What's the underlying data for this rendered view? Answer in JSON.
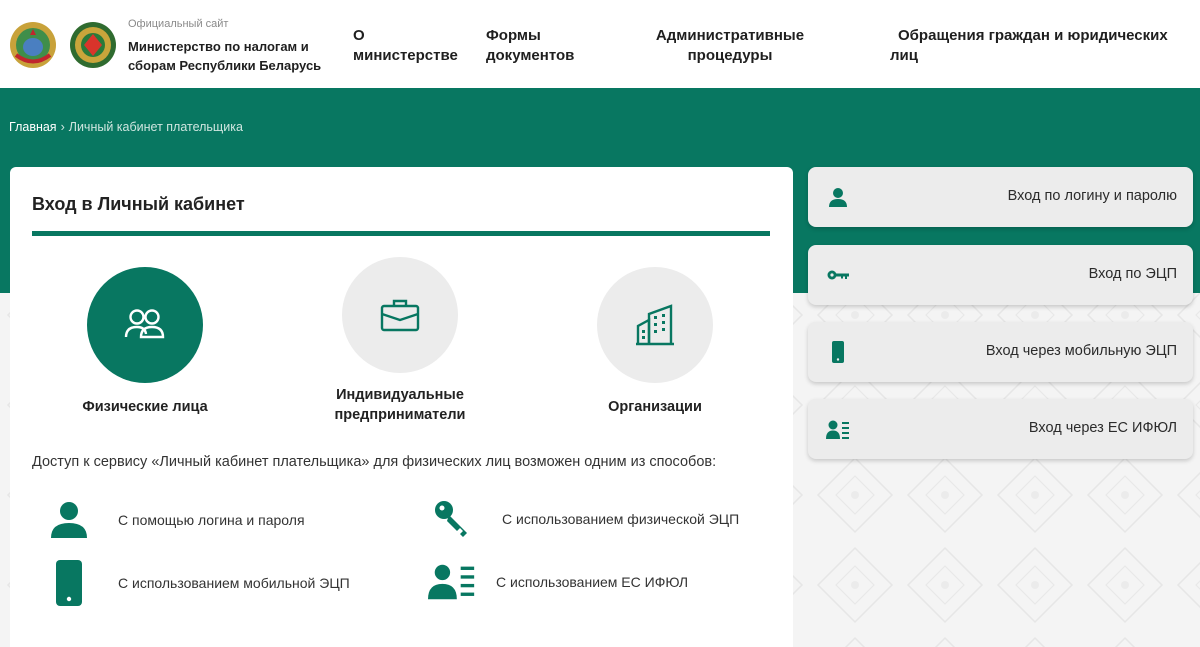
{
  "header": {
    "site_small": "Официальный сайт",
    "site_name": "Министерство по налогам и сборам Республики Беларусь",
    "nav": [
      {
        "label": "О министерстве"
      },
      {
        "label": "Формы документов"
      },
      {
        "label": "Административные процедуры"
      },
      {
        "label": "Обращения граждан и юридических лиц"
      }
    ]
  },
  "breadcrumb": {
    "home": "Главная",
    "current": "Личный кабинет плательщика"
  },
  "card": {
    "title": "Вход в Личный кабинет",
    "categories": [
      {
        "label": "Физические лица",
        "icon": "users-icon",
        "active": true
      },
      {
        "label": "Индивидуальные предприниматели",
        "icon": "briefcase-icon",
        "active": false
      },
      {
        "label": "Организации",
        "icon": "building-icon",
        "active": false
      }
    ],
    "access_text": "Доступ к сервису «Личный кабинет плательщика» для физических лиц возможен одним из способов:",
    "methods": [
      {
        "label": "С помощью логина и пароля",
        "icon": "person-icon"
      },
      {
        "label": "С использованием физической ЭЦП",
        "icon": "key-icon"
      },
      {
        "label": "С использованием мобильной ЭЦП",
        "icon": "mobile-icon"
      },
      {
        "label": "С использованием ЕС ИФЮЛ",
        "icon": "id-card-icon"
      }
    ]
  },
  "side_buttons": [
    {
      "label": "Вход по логину и паролю",
      "icon": "person-icon"
    },
    {
      "label": "Вход по ЭЦП",
      "icon": "key-icon"
    },
    {
      "label": "Вход через мобильную ЭЦП",
      "icon": "mobile-icon"
    },
    {
      "label": "Вход через ЕС ИФЮЛ",
      "icon": "id-card-icon"
    }
  ],
  "colors": {
    "brand_green": "#087761",
    "card_bg": "#ffffff",
    "button_bg": "#ececec"
  }
}
